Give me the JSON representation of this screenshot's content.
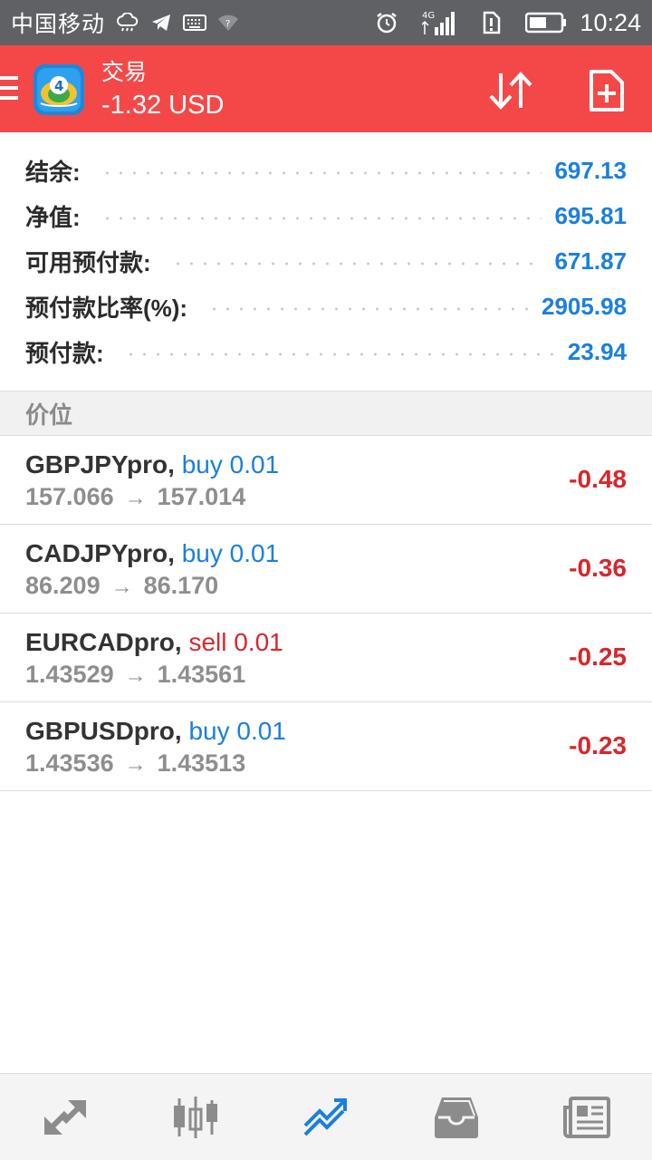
{
  "status_bar": {
    "carrier": "中国移动",
    "network": "4G",
    "time": "10:24"
  },
  "app_bar": {
    "title": "交易",
    "subtitle": "-1.32 USD"
  },
  "account": [
    {
      "label": "结余:",
      "value": "697.13"
    },
    {
      "label": "净值:",
      "value": "695.81"
    },
    {
      "label": "可用预付款:",
      "value": "671.87"
    },
    {
      "label": "预付款比率(%):",
      "value": "2905.98"
    },
    {
      "label": "预付款:",
      "value": "23.94"
    }
  ],
  "positions_header": "价位",
  "positions": [
    {
      "symbol": "GBPJPYpro",
      "side": "buy 0.01",
      "open_price": "157.066",
      "current_price": "157.014",
      "profit": "-0.48"
    },
    {
      "symbol": "CADJPYpro",
      "side": "buy 0.01",
      "open_price": "86.209",
      "current_price": "86.170",
      "profit": "-0.36"
    },
    {
      "symbol": "EURCADpro",
      "side": "sell 0.01",
      "open_price": "1.43529",
      "current_price": "1.43561",
      "profit": "-0.25"
    },
    {
      "symbol": "GBPUSDpro",
      "side": "buy 0.01",
      "open_price": "1.43536",
      "current_price": "1.43513",
      "profit": "-0.23"
    }
  ],
  "arrow_glyph": "→",
  "bottom_nav": [
    {
      "icon": "quotes-arrows-icon",
      "active": false
    },
    {
      "icon": "candlestick-chart-icon",
      "active": false
    },
    {
      "icon": "trade-icon",
      "active": true
    },
    {
      "icon": "inbox-icon",
      "active": false
    },
    {
      "icon": "news-icon",
      "active": false
    }
  ],
  "colors": {
    "app_bar": "#f44848",
    "status_bar": "#5f6164",
    "value_blue": "#1a7fe0",
    "loss_red": "#d9262c",
    "nav_active": "#1a7fe0",
    "nav_inactive": "#8c8c8c"
  }
}
